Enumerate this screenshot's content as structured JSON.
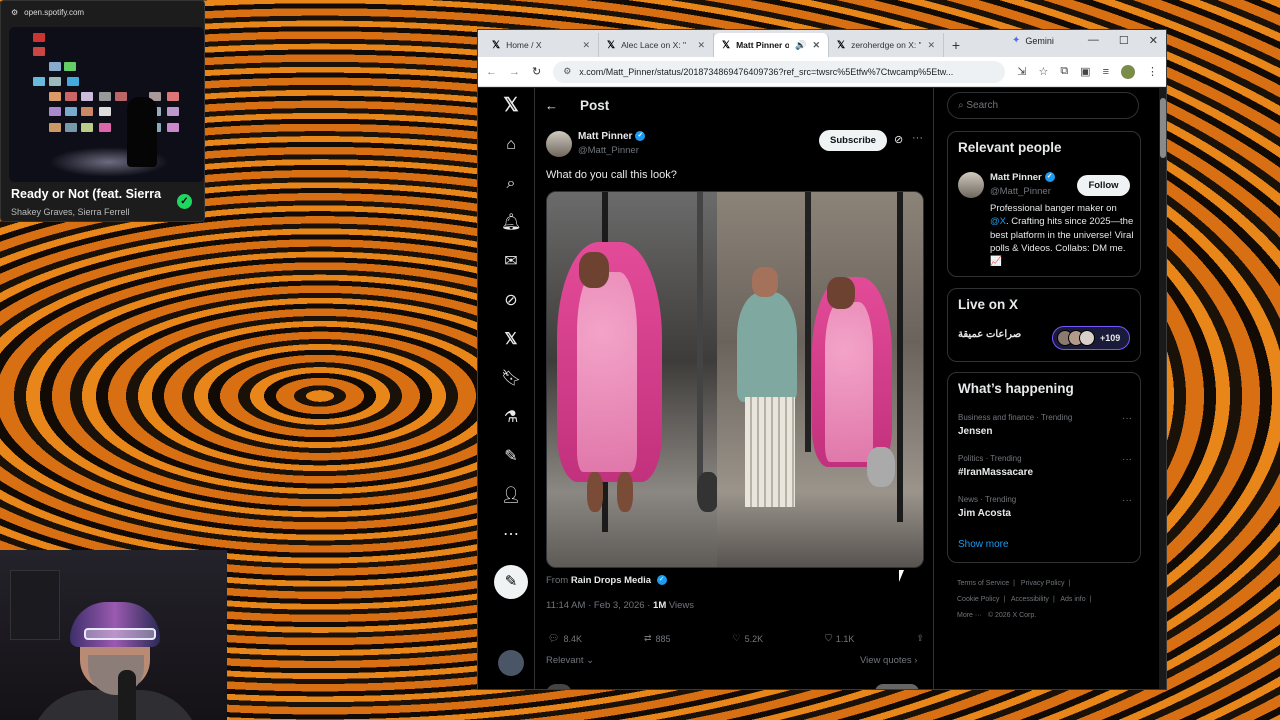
{
  "spotify": {
    "url": "open.spotify.com",
    "track": "Ready or Not (feat. Sierra",
    "artist": "Shakey Graves, Sierra Ferrell"
  },
  "browser": {
    "tabs": [
      {
        "label": "Home / X",
        "active": false
      },
      {
        "label": "Alec Lace on X: \"",
        "active": false
      },
      {
        "label": "Matt Pinner o",
        "active": true
      },
      {
        "label": "zeroherdge on X: \"",
        "active": false
      }
    ],
    "gemini_label": "Gemini",
    "url": "x.com/Matt_Pinner/status/2018734869476409736?ref_src=twsrc%5Etfw%7Ctwcamp%5Etw..."
  },
  "post": {
    "header_title": "Post",
    "author_name": "Matt Pinner",
    "author_handle": "@Matt_Pinner",
    "subscribe_label": "Subscribe",
    "text": "What do you call this look?",
    "from_prefix": "From",
    "from_source": "Rain Drops Media",
    "timestamp": "11:14 AM · Feb 3, 2026 ·",
    "views_count": "1M",
    "views_label": "Views",
    "actions": {
      "replies": "8.4K",
      "reposts": "885",
      "likes": "5.2K",
      "bookmarks": "1.1K"
    },
    "relevant_label": "Relevant",
    "view_quotes_label": "View quotes"
  },
  "sidebar": {
    "search_placeholder": "Search",
    "relevant_people_title": "Relevant people",
    "person": {
      "name": "Matt Pinner",
      "handle": "@Matt_Pinner",
      "follow_label": "Follow",
      "bio_prefix": "Professional banger maker on",
      "bio_mention": "@X",
      "bio_suffix": ". Crafting hits since 2025—the best platform in the universe! Viral polls & Videos. Collabs: DM me.📈"
    },
    "live_title": "Live on X",
    "live_space": "صراعات عميقة",
    "live_count": "+109",
    "happening_title": "What’s happening",
    "trends": [
      {
        "category": "Business and finance · Trending",
        "name": "Jensen"
      },
      {
        "category": "Politics · Trending",
        "name": "#IranMassacare"
      },
      {
        "category": "News · Trending",
        "name": "Jim Acosta"
      }
    ],
    "show_more": "Show more",
    "footer": [
      "Terms of Service",
      "|",
      "Privacy Policy",
      "|",
      "Cookie Policy",
      "|",
      "Accessibility",
      "|",
      "Ads info",
      "|",
      "More ···",
      "© 2026 X Corp."
    ]
  },
  "colors": {
    "x_blue": "#1d9bf0",
    "x_background": "#000000",
    "spotify_green": "#1ed760",
    "desktop_orange": "#e9861a"
  },
  "icons": [
    "x-logo-icon",
    "home-icon",
    "explore-icon",
    "notifications-icon",
    "messages-icon",
    "grok-icon",
    "x-premium-icon",
    "bookmarks-icon",
    "jobs-icon",
    "lists-icon",
    "profile-icon",
    "more-icon",
    "compose-icon"
  ]
}
